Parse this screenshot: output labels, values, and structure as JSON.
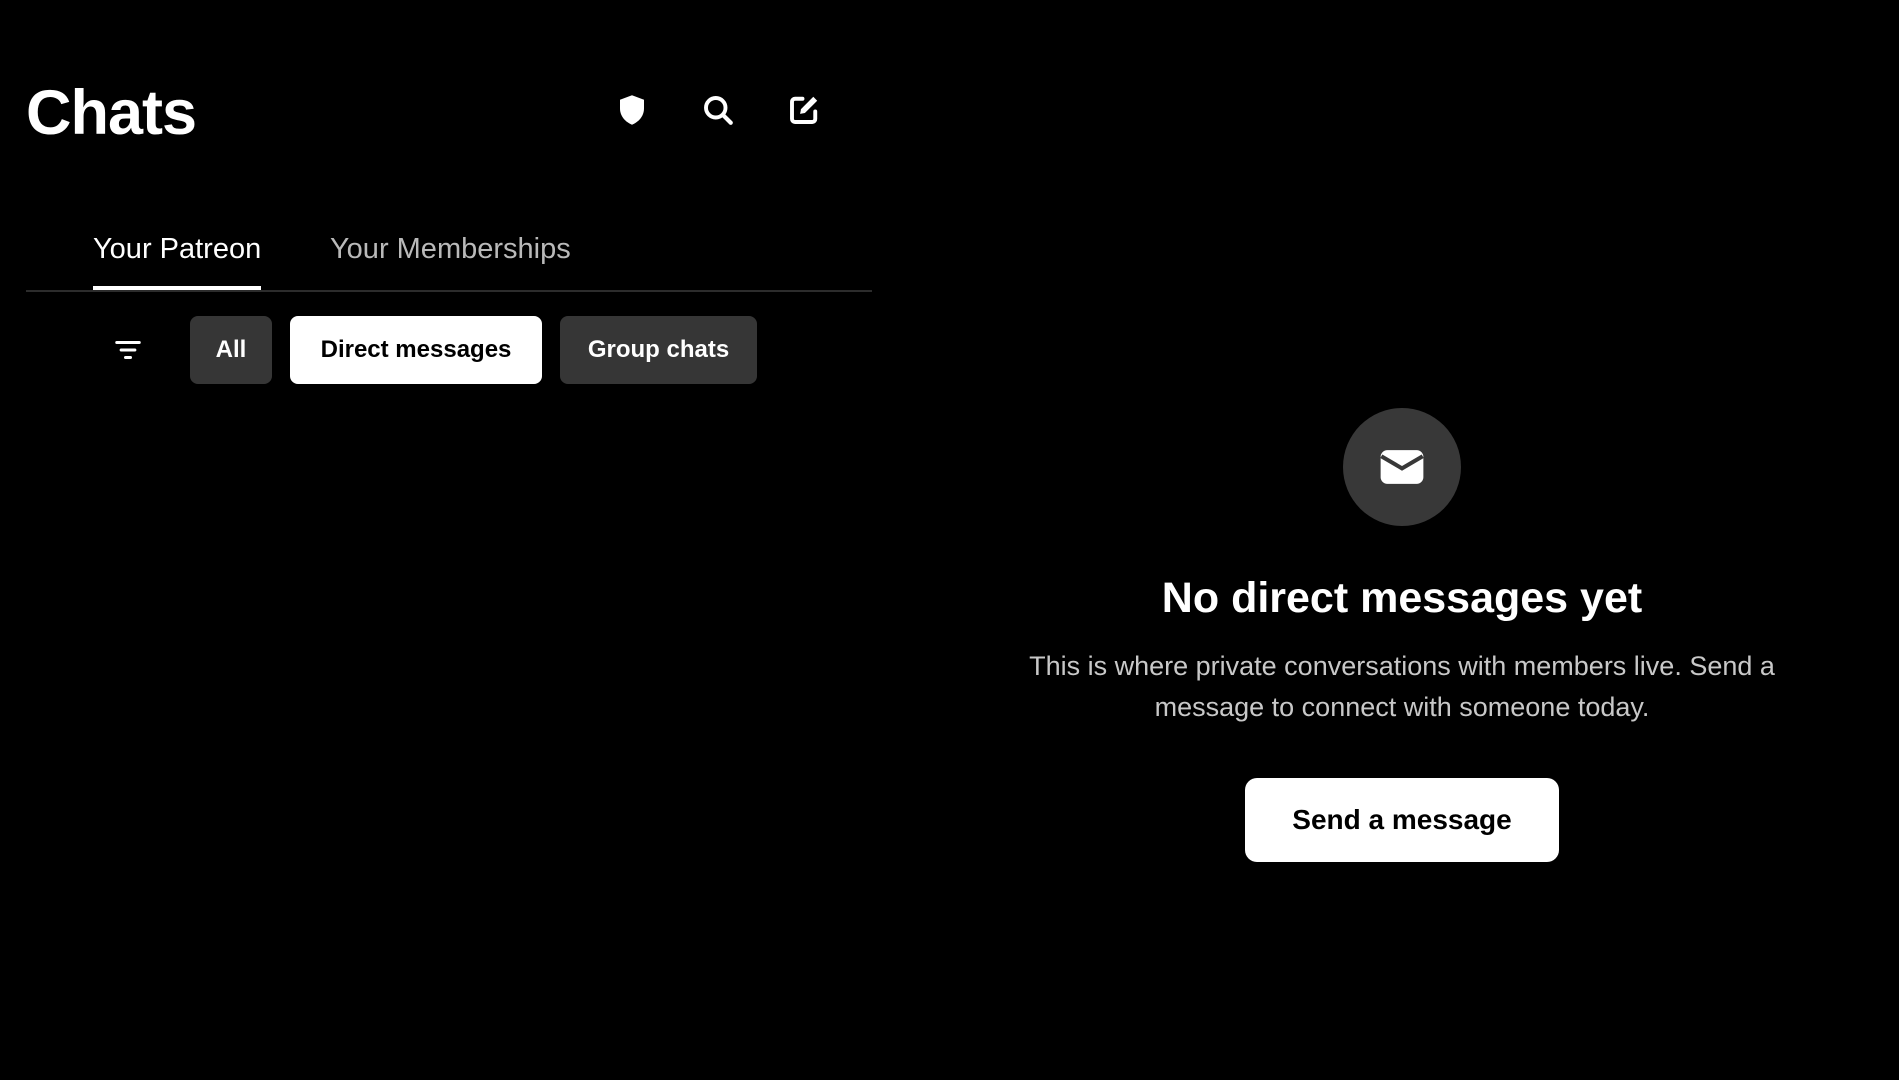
{
  "header": {
    "title": "Chats",
    "actions": [
      {
        "name": "shield-icon",
        "label": "Safety"
      },
      {
        "name": "search-icon",
        "label": "Search"
      },
      {
        "name": "compose-icon",
        "label": "New message"
      }
    ]
  },
  "tabs": [
    {
      "label": "Your Patreon",
      "active": true
    },
    {
      "label": "Your Memberships",
      "active": false
    }
  ],
  "filters": {
    "icon": "filter-icon",
    "chips": [
      {
        "label": "All",
        "selected": false
      },
      {
        "label": "Direct messages",
        "selected": true
      },
      {
        "label": "Group chats",
        "selected": false
      }
    ]
  },
  "empty_state": {
    "icon": "envelope-icon",
    "title": "No direct messages yet",
    "description": "This is where private conversations with members live. Send a message to connect with someone today.",
    "button_label": "Send a message"
  },
  "colors": {
    "background": "#000000",
    "chip_dark": "#363636",
    "chip_selected": "#ffffff",
    "icon_circle": "#383838",
    "muted_text": "#c8c8c8",
    "tab_divider": "#2c2c2c"
  }
}
